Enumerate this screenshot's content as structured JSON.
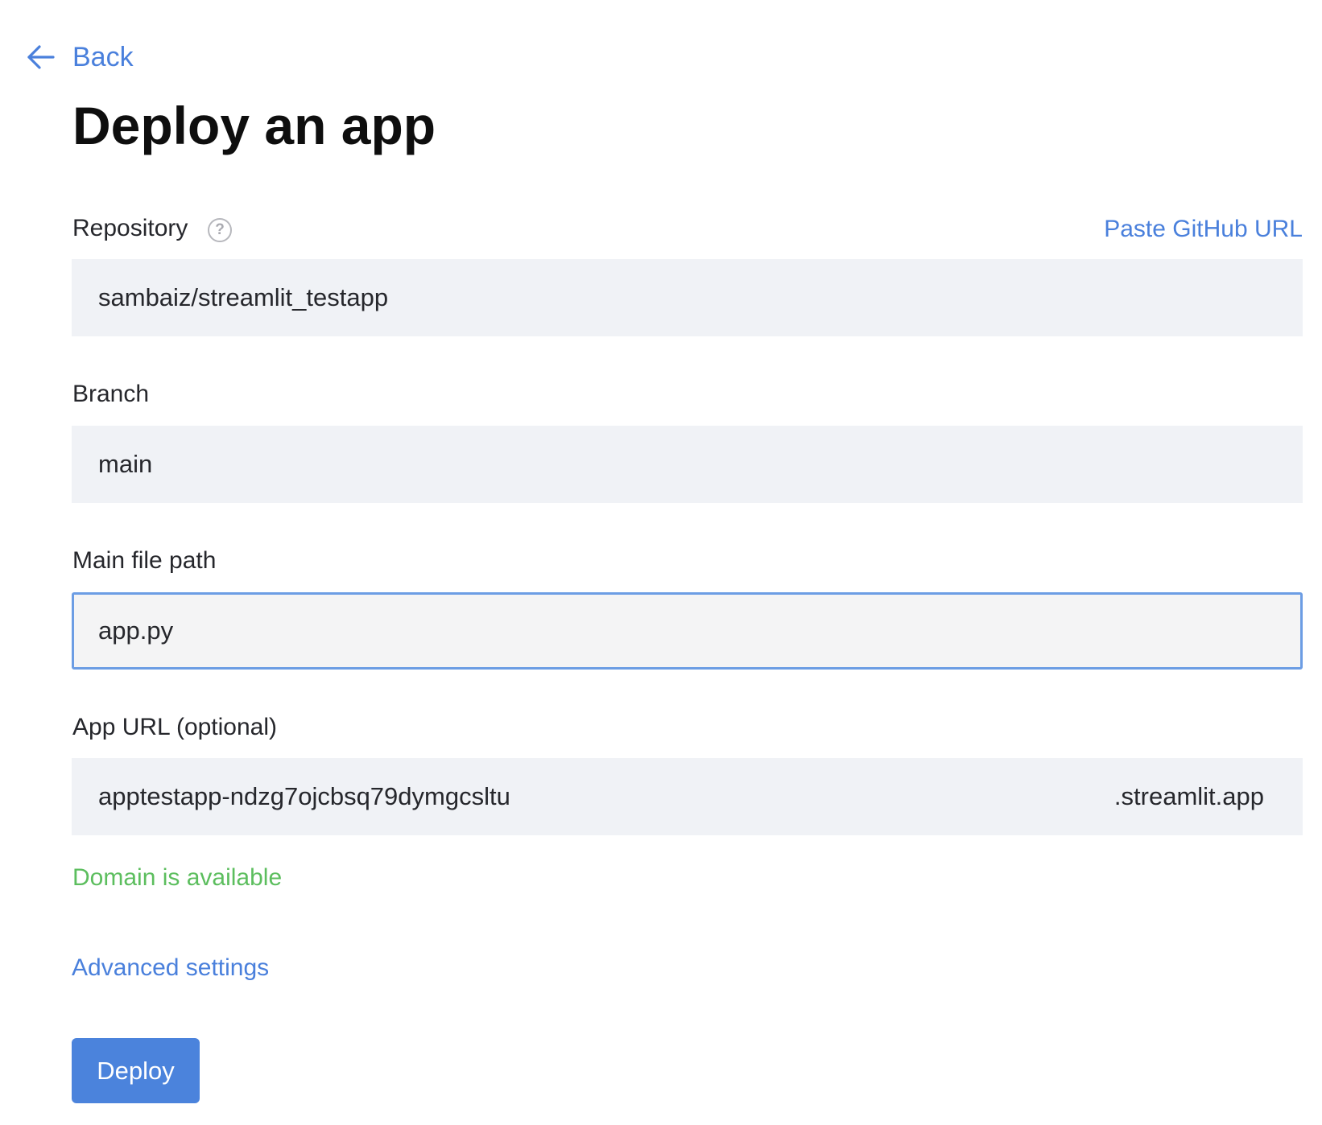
{
  "nav": {
    "back_label": "Back"
  },
  "page": {
    "title": "Deploy an app"
  },
  "form": {
    "repository": {
      "label": "Repository",
      "help_icon": "question-circle-icon",
      "paste_link": "Paste GitHub URL",
      "value": "sambaiz/streamlit_testapp"
    },
    "branch": {
      "label": "Branch",
      "value": "main"
    },
    "main_file": {
      "label": "Main file path",
      "value": "app.py",
      "focused": true
    },
    "app_url": {
      "label": "App URL (optional)",
      "value": "apptestapp-ndzg7ojcbsq79dymgcsltu",
      "suffix": ".streamlit.app",
      "status": "Domain is available"
    },
    "advanced_link": "Advanced settings",
    "deploy_label": "Deploy"
  },
  "colors": {
    "accent": "#4a80dc",
    "button": "#4b83dc",
    "success": "#5cbe5e",
    "input_bg": "#f0f2f6",
    "focus_border": "#6c9de4"
  }
}
